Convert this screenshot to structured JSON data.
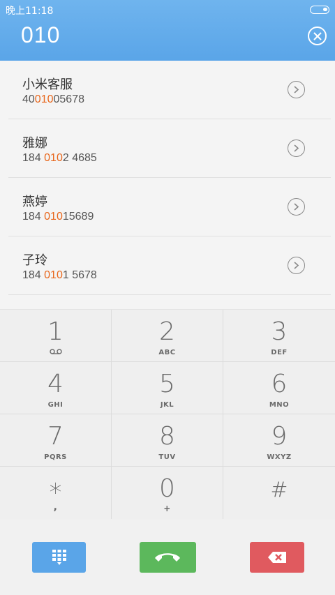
{
  "status_bar": {
    "time": "晚上11:18"
  },
  "dialer": {
    "input": "010"
  },
  "contacts": [
    {
      "name": "小米客服",
      "number_before": "40",
      "number_match": "010",
      "number_after": "05678"
    },
    {
      "name": "雅娜",
      "number_before": "184 ",
      "number_match": "010",
      "number_after": "2 4685"
    },
    {
      "name": "燕婷",
      "number_before": "184 ",
      "number_match": "010",
      "number_after": "15689"
    },
    {
      "name": "子玲",
      "number_before": "184 ",
      "number_match": "010",
      "number_after": "1 5678"
    }
  ],
  "keypad": [
    {
      "digit": "1",
      "letters": "ꝏ"
    },
    {
      "digit": "2",
      "letters": "ABC"
    },
    {
      "digit": "3",
      "letters": "DEF"
    },
    {
      "digit": "4",
      "letters": "GHI"
    },
    {
      "digit": "5",
      "letters": "JKL"
    },
    {
      "digit": "6",
      "letters": "MNO"
    },
    {
      "digit": "7",
      "letters": "PQRS"
    },
    {
      "digit": "8",
      "letters": "TUV"
    },
    {
      "digit": "9",
      "letters": "WXYZ"
    },
    {
      "digit": "*",
      "letters": ","
    },
    {
      "digit": "0",
      "letters": "+"
    },
    {
      "digit": "#",
      "letters": ""
    }
  ],
  "colors": {
    "header": "#5aa5e8",
    "highlight": "#e8661b",
    "keypad_toggle": "#5aa5e8",
    "call": "#5cb85c",
    "delete": "#e05a5f"
  }
}
